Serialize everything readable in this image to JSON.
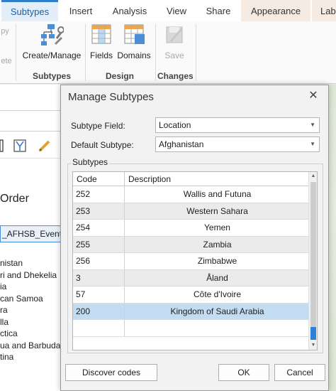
{
  "ribbon": {
    "tabs": [
      {
        "label": "Subtypes",
        "active": true
      },
      {
        "label": "Insert"
      },
      {
        "label": "Analysis"
      },
      {
        "label": "View"
      },
      {
        "label": "Share"
      },
      {
        "label": "Appearance",
        "contextual": true
      },
      {
        "label": "Lab",
        "contextual": true
      }
    ],
    "partial_left": {
      "copy": "py",
      "delete": "ete"
    },
    "buttons": {
      "create_manage": "Create/Manage",
      "fields": "Fields",
      "domains": "Domains",
      "save": "Save"
    },
    "groups": {
      "subtypes": "Subtypes",
      "design": "Design",
      "changes": "Changes"
    }
  },
  "left_pane": {
    "order_heading": "Order",
    "layer_name": "_AFHSB_Events_",
    "items": [
      "nistan",
      "ri and Dhekelia",
      "ia",
      "can Samoa",
      "ra",
      "lla",
      "ctica",
      "ua and Barbuda",
      "tina"
    ]
  },
  "dialog": {
    "title": "Manage Subtypes",
    "subtype_field_label": "Subtype Field:",
    "subtype_field_value": "Location",
    "default_subtype_label": "Default Subtype:",
    "default_subtype_value": "Afghanistan",
    "subtypes_group_label": "Subtypes",
    "columns": {
      "code": "Code",
      "description": "Description"
    },
    "rows": [
      {
        "code": "252",
        "description": "Wallis and Futuna"
      },
      {
        "code": "253",
        "description": "Western Sahara"
      },
      {
        "code": "254",
        "description": "Yemen"
      },
      {
        "code": "255",
        "description": "Zambia"
      },
      {
        "code": "256",
        "description": "Zimbabwe"
      },
      {
        "code": "3",
        "description": "Åland"
      },
      {
        "code": "57",
        "description": "Côte d'Ivoire"
      },
      {
        "code": "200",
        "description": "Kingdom of Saudi Arabia",
        "selected": true
      },
      {
        "code": "",
        "description": ""
      }
    ],
    "buttons": {
      "discover": "Discover codes",
      "ok": "OK",
      "cancel": "Cancel"
    }
  },
  "colors": {
    "accent": "#2f80c8",
    "selected_row": "#c4dcf1",
    "contextual_tab": "#f6ebe2"
  }
}
